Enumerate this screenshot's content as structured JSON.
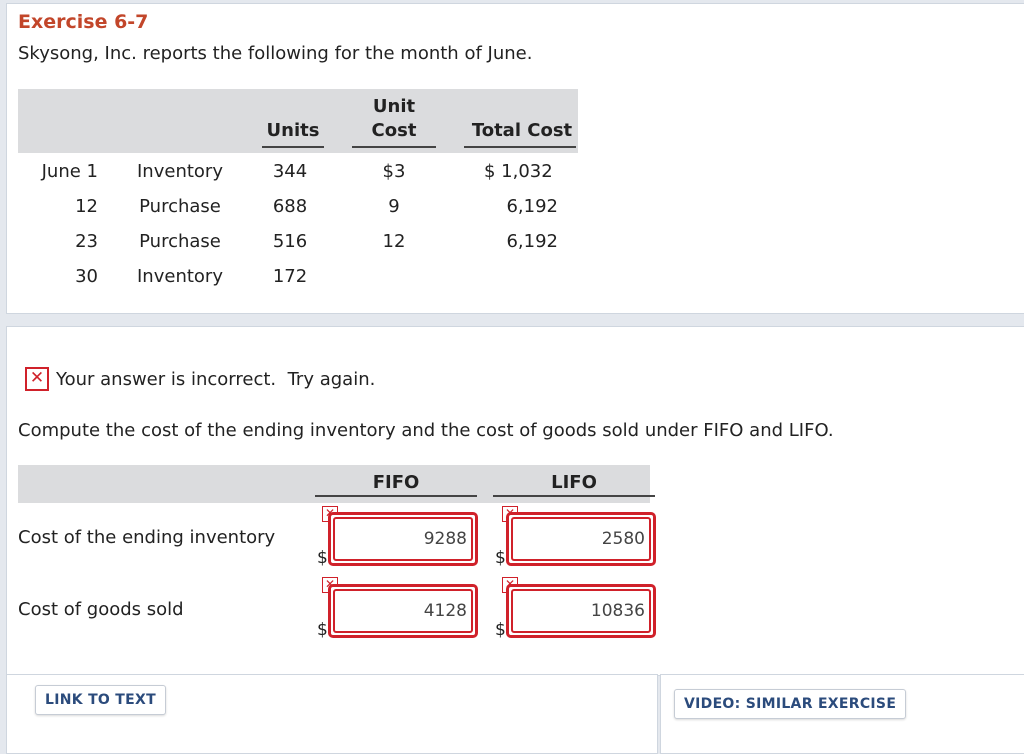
{
  "exercise": {
    "title": "Exercise 6-7",
    "intro": "Skysong, Inc. reports the following for the month of June."
  },
  "table": {
    "headers": {
      "units": "Units",
      "unit_cost_line1": "Unit",
      "unit_cost_line2": "Cost",
      "total_cost": "Total Cost"
    },
    "rows": [
      {
        "date": "June 1",
        "desc": "Inventory",
        "units": "344",
        "unit_cost": "$3",
        "total_cost": "$ 1,032"
      },
      {
        "date": "12",
        "desc": "Purchase",
        "units": "688",
        "unit_cost": "9",
        "total_cost": "6,192"
      },
      {
        "date": "23",
        "desc": "Purchase",
        "units": "516",
        "unit_cost": "12",
        "total_cost": "6,192"
      },
      {
        "date": "30",
        "desc": "Inventory",
        "units": "172",
        "unit_cost": "",
        "total_cost": ""
      }
    ]
  },
  "feedback": {
    "icon": "x-icon",
    "message": "Your answer is incorrect.  Try again."
  },
  "question": "Compute the cost of the ending inventory and the cost of goods sold under FIFO and LIFO.",
  "answers": {
    "headers": {
      "fifo": "FIFO",
      "lifo": "LIFO"
    },
    "currency": "$",
    "rows": [
      {
        "label": "Cost of the ending inventory",
        "fifo": "9288",
        "lifo": "2580"
      },
      {
        "label": "Cost of goods sold",
        "fifo": "4128",
        "lifo": "10836"
      }
    ],
    "error_color": "#d0212a"
  },
  "footer": {
    "link_to_text": "LINK TO TEXT",
    "video": "VIDEO: SIMILAR EXERCISE"
  },
  "colors": {
    "title": "#c2462a",
    "header_bg": "#dbdcde",
    "link": "#2b4b7c"
  }
}
